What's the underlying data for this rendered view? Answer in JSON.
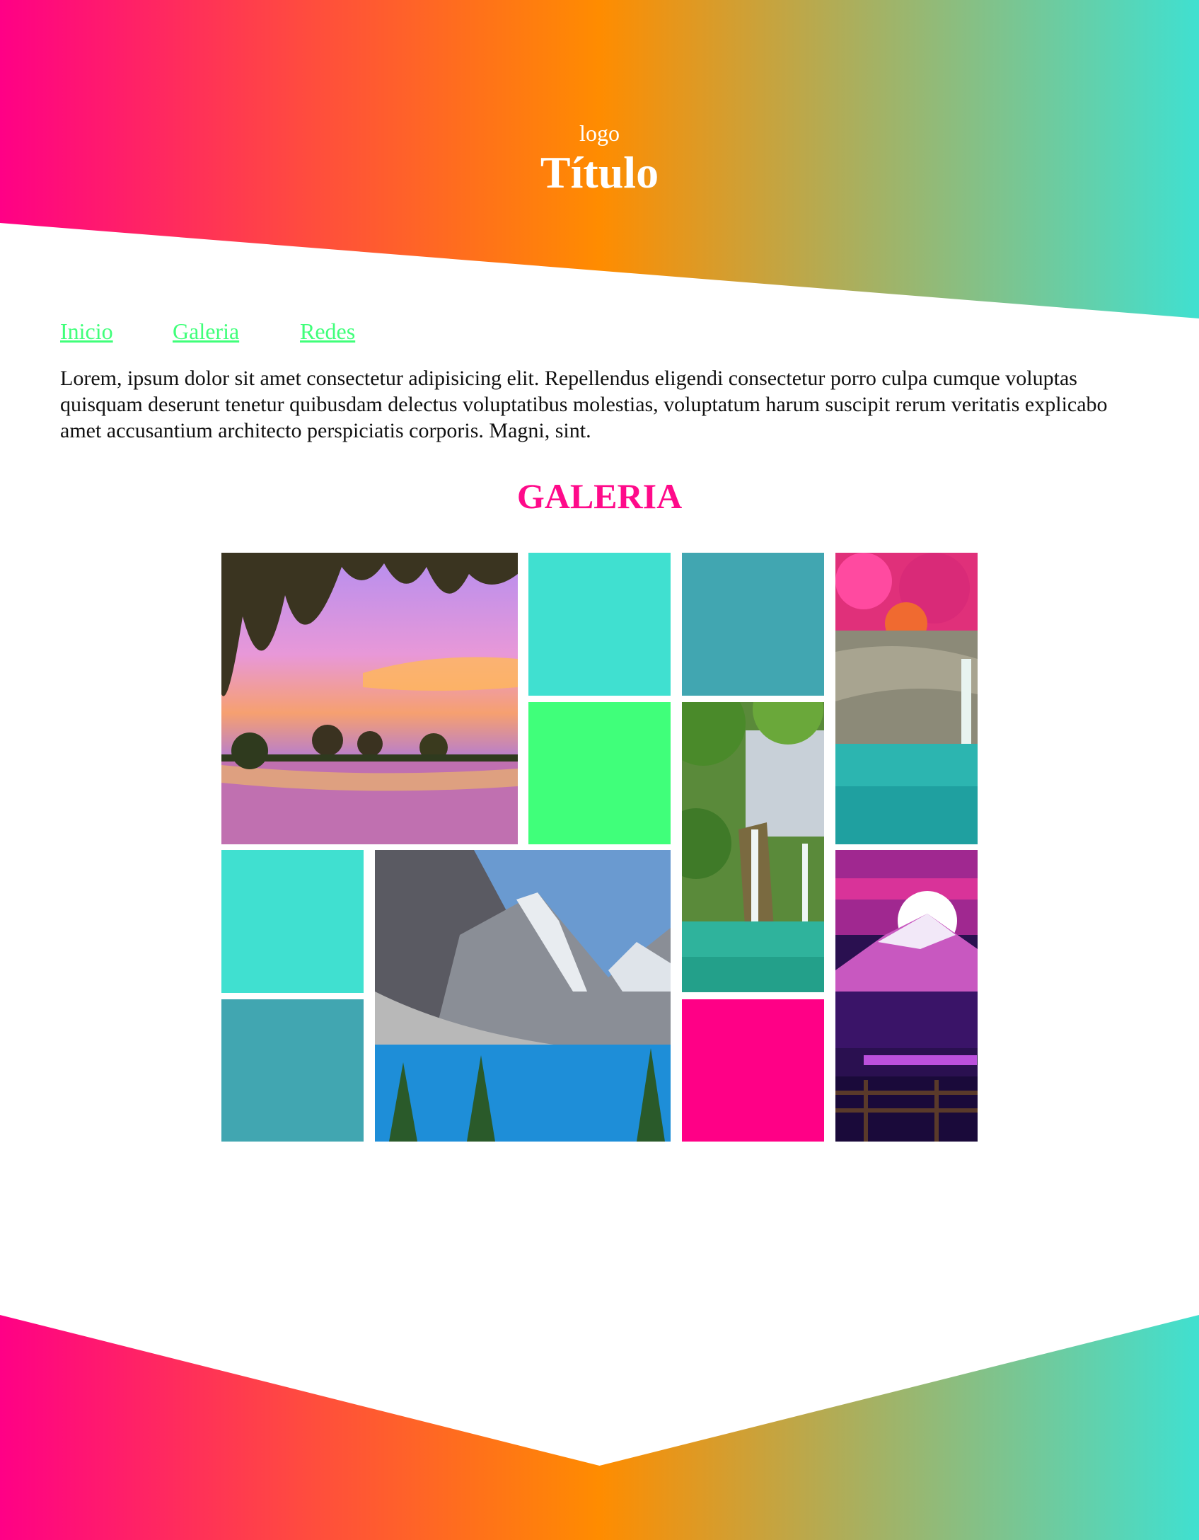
{
  "header": {
    "logo": "logo",
    "title": "Título"
  },
  "nav": {
    "items": [
      {
        "label": "Inicio"
      },
      {
        "label": "Galeria"
      },
      {
        "label": "Redes"
      }
    ]
  },
  "intro": {
    "text": "Lorem, ipsum dolor sit amet consectetur adipisicing elit. Repellendus eligendi consectetur porro culpa cumque voluptas quisquam deserunt tenetur quibusdam delectus voluptatibus molestias, voluptatum harum suscipit rerum veritatis explicabo amet accusantium architecto perspiciatis corporis. Magni, sint."
  },
  "gallery": {
    "heading": "GALERIA",
    "colors": {
      "turquoise": "#40e0d0",
      "teal": "#41a6b1",
      "green": "#40ff7a",
      "pink": "#ff0086"
    }
  },
  "theme": {
    "gradient": [
      "#ff0086",
      "#ff8c00",
      "#40e0d0"
    ],
    "link_color": "#40ff7a",
    "heading_color": "#ff0a8a"
  }
}
